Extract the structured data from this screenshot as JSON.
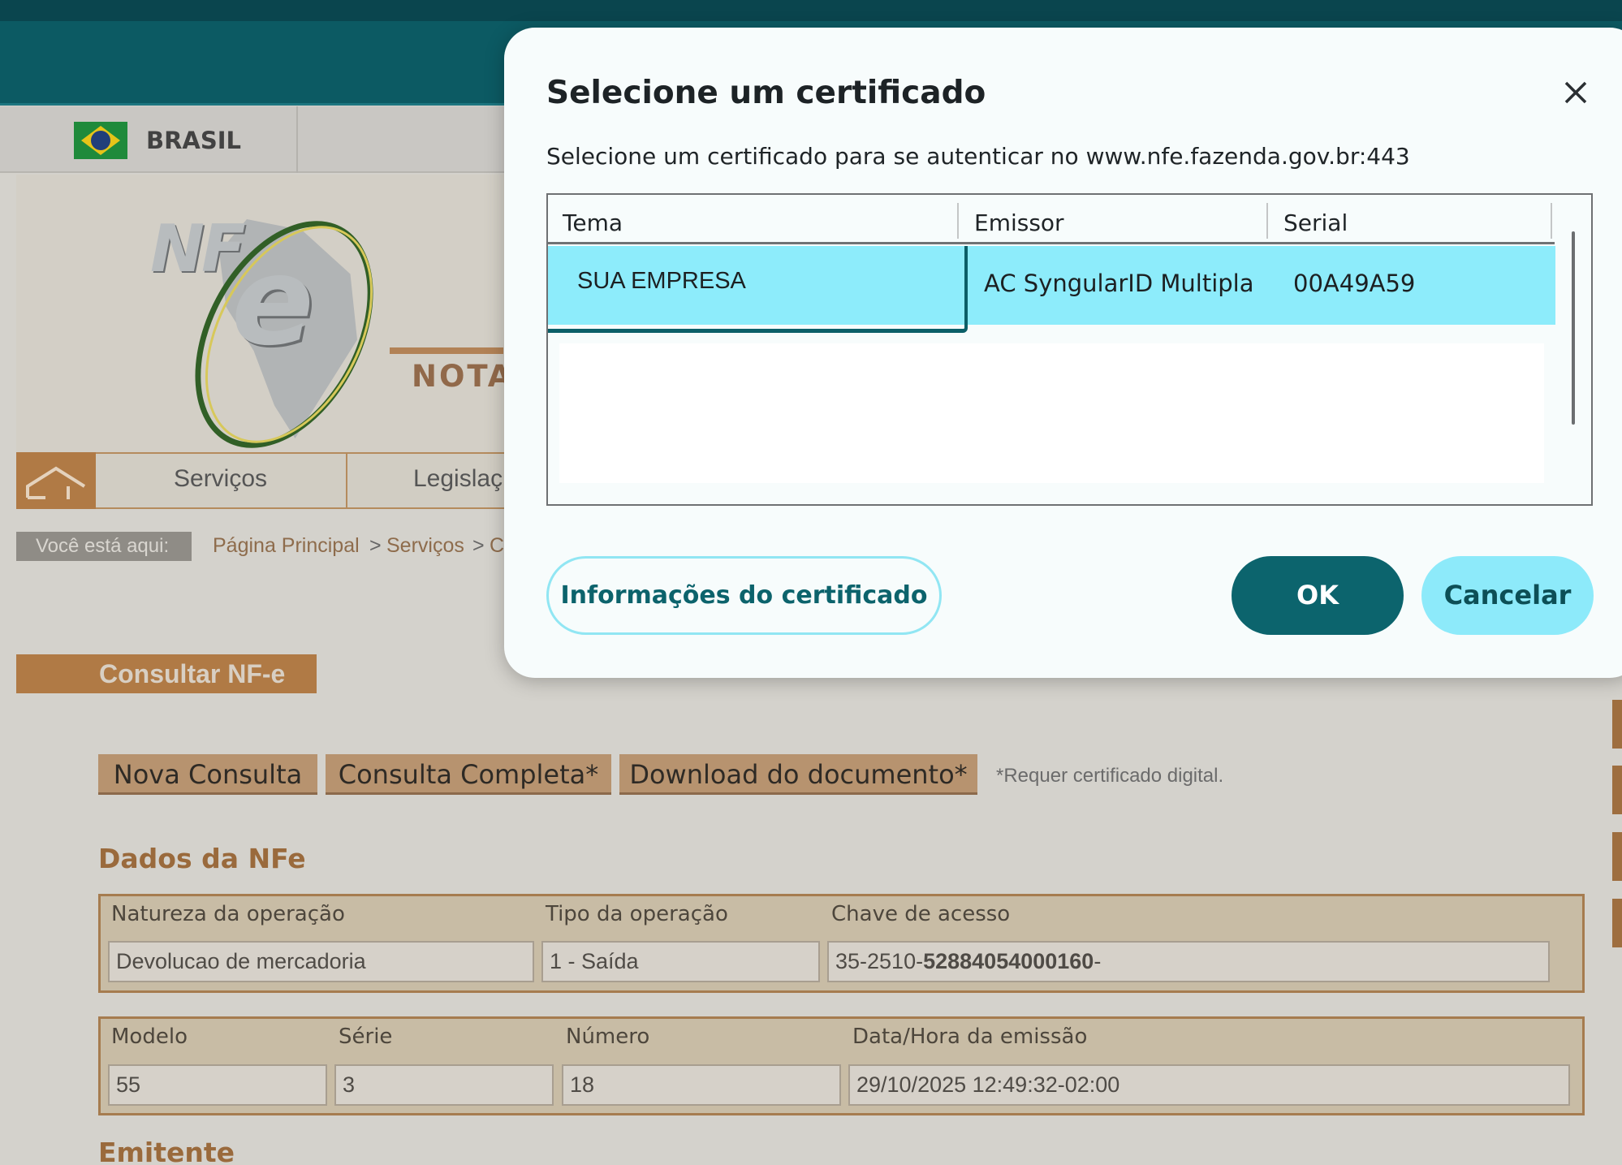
{
  "header": {
    "country_label": "BRASIL",
    "banner_text": "NOTA",
    "logo_letters": "NF",
    "logo_e": "e"
  },
  "menu": {
    "items": [
      {
        "label": "Serviços"
      },
      {
        "label": "Legislaç"
      }
    ]
  },
  "breadcrumb": {
    "prefix": "Você está aqui:",
    "items": [
      "Página Principal",
      "Serviços",
      "C"
    ],
    "separator": ">"
  },
  "page": {
    "title": "Consultar NF-e",
    "actions": {
      "new_query": "Nova Consulta",
      "full_query": "Consulta Completa*",
      "download": "Download do documento*",
      "note": "*Requer certificado digital."
    },
    "sections": {
      "dados_title": "Dados da NFe",
      "emitente_title": "Emitente"
    },
    "fields_row1": {
      "natureza_label": "Natureza da operação",
      "natureza_value": "Devolucao de mercadoria",
      "tipo_label": "Tipo da operação",
      "tipo_value": "1 - Saída",
      "chave_label": "Chave de acesso",
      "chave_prefix": "35-2510-",
      "chave_bold": "52884054000160",
      "chave_suffix": "-"
    },
    "fields_row2": {
      "modelo_label": "Modelo",
      "modelo_value": "55",
      "serie_label": "Série",
      "serie_value": "3",
      "numero_label": "Número",
      "numero_value": "18",
      "data_label": "Data/Hora da emissão",
      "data_value": "29/10/2025 12:49:32-02:00"
    }
  },
  "dialog": {
    "title": "Selecione um certificado",
    "subtitle": "Selecione um certificado para se autenticar no www.nfe.fazenda.gov.br:443",
    "columns": [
      "Tema",
      "Emissor",
      "Serial"
    ],
    "rows": [
      {
        "tema": "SUA EMPRESA",
        "emissor": "AC SyngularID Multipla",
        "serial": "00A49A59",
        "selected": true
      }
    ],
    "buttons": {
      "info": "Informações do certificado",
      "ok": "OK",
      "cancel": "Cancelar"
    }
  },
  "colors": {
    "header_teal": "#0c5a63",
    "accent_brown": "#b07a45",
    "dialog_primary": "#0c646d",
    "dialog_selection": "#8decfb"
  }
}
